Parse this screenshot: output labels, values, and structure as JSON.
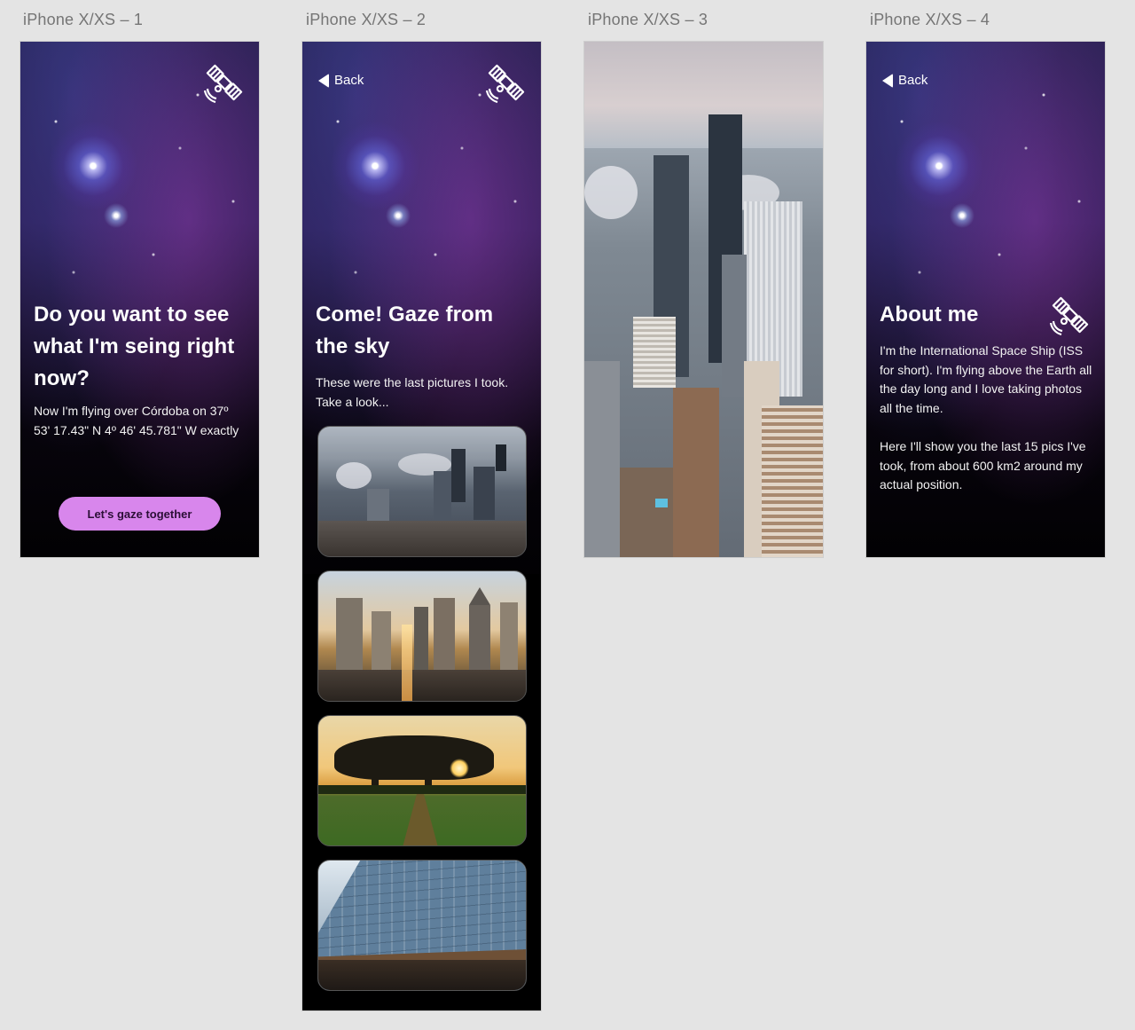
{
  "artboards": [
    {
      "label": "iPhone X/XS – 1"
    },
    {
      "label": "iPhone X/XS – 2"
    },
    {
      "label": "iPhone X/XS – 3"
    },
    {
      "label": "iPhone X/XS – 4"
    }
  ],
  "screen1": {
    "title": "Do you want to see what I'm seing right now?",
    "text": "Now I'm flying over Córdoba on 37º 53' 17.43\" N 4º 46' 45.781\" W exactly",
    "cta_label": "Let's gaze together"
  },
  "screen2": {
    "back_label": "Back",
    "title": "Come! Gaze from the sky",
    "text": "These were the last pictures I took. Take a look...",
    "photos": [
      "city-aerial-fog-photo",
      "city-skyline-sunset-photo",
      "tree-sunset-field-photo",
      "glass-building-photo"
    ]
  },
  "screen4": {
    "back_label": "Back",
    "title": "About me",
    "paragraph1": "I'm the International Space Ship (ISS for short). I'm flying above the Earth all the day long and I love taking photos all the time.",
    "paragraph2": "Here I'll show you the last 15 pics I've took, from about 600 km2 around my actual position."
  },
  "colors": {
    "canvas": "#e4e4e4",
    "accent": "#d886ec",
    "text_on_dark": "#ffffff"
  },
  "icons": [
    "satellite-icon",
    "back-arrow-icon"
  ]
}
